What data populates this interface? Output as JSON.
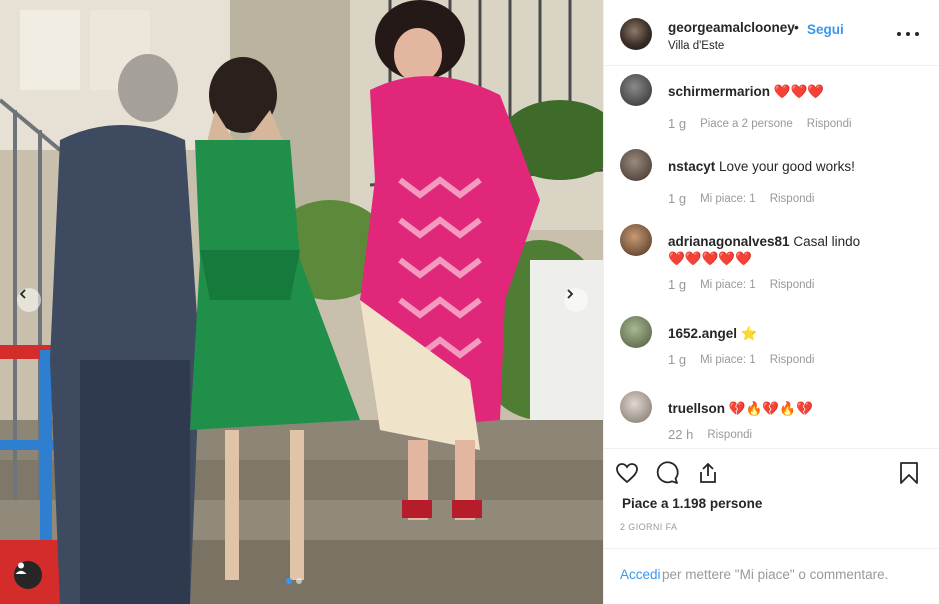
{
  "post": {
    "username": "georgeamalclooney",
    "separator": "•",
    "follow_label": "Segui",
    "location": "Villa d'Este",
    "more_options_icon": "more-horizontal-icon"
  },
  "comments": [
    {
      "username": "schirmermarion",
      "text": "❤️❤️❤️",
      "time": "1 g",
      "likes": "Piace a 2 persone",
      "reply": "Rispondi",
      "avatar_color": "#3a3a3a"
    },
    {
      "username": "nstacyt",
      "text": "Love your good works!",
      "time": "1 g",
      "likes": "Mi piace: 1",
      "reply": "Rispondi",
      "avatar_color": "#5a5048"
    },
    {
      "username": "adrianagonalves81",
      "text": "Casal lindo",
      "text2": "❤️❤️❤️❤️❤️",
      "time": "1 g",
      "likes": "Mi piace: 1",
      "reply": "Rispondi",
      "avatar_color": "#6b4a32"
    },
    {
      "username": "1652.angel",
      "text": "⭐",
      "time": "1 g",
      "likes": "Mi piace: 1",
      "reply": "Rispondi",
      "avatar_color": "#7a8a6a"
    },
    {
      "username": "truellson",
      "text": "💔🔥💔🔥💔",
      "time": "22 h",
      "reply": "Rispondi",
      "avatar_color": "#c8c0b8"
    }
  ],
  "actions": {
    "like_icon": "heart-outline-icon",
    "comment_icon": "comment-bubble-icon",
    "share_icon": "share-icon",
    "save_icon": "bookmark-icon",
    "likes_text": "Piace a 1.198 persone",
    "posted_ago": "2 GIORNI FA"
  },
  "login": {
    "login_link": "Accedi",
    "rest_text": "per mettere \"Mi piace\" o commentare."
  },
  "carousel": {
    "prev_icon": "chevron-left-icon",
    "next_icon": "chevron-right-icon",
    "tag_icon": "user-tag-icon",
    "slide_index": 1,
    "slide_count": 2
  },
  "colors": {
    "accent": "#3897f0",
    "text": "#262626",
    "muted": "#999999",
    "border": "#efefef",
    "dress_green": "#1f8f4a",
    "robe_pink": "#e0277a"
  }
}
